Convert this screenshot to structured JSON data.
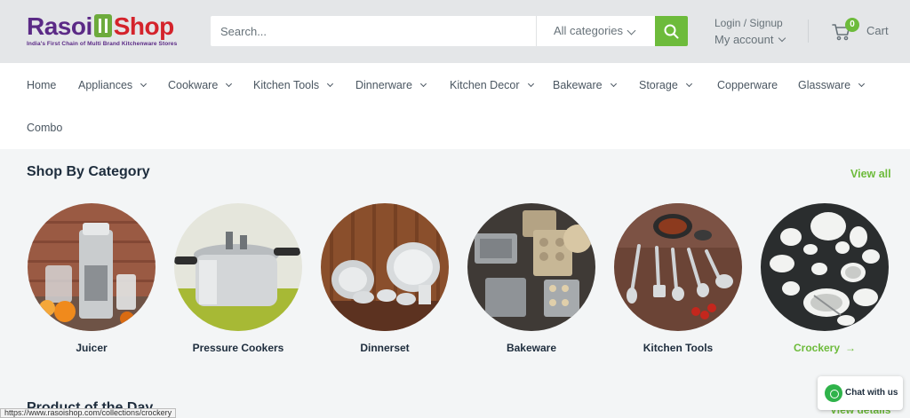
{
  "header": {
    "logo": {
      "word1": "Rasoi",
      "word2": "Shop",
      "tagline": "India's First Chain of Multi Brand Kitchenware Stores"
    },
    "search": {
      "placeholder": "Search...",
      "category": "All categories"
    },
    "account": {
      "login": "Login / Signup",
      "my_account": "My account"
    },
    "cart": {
      "count": "0",
      "label": "Cart"
    }
  },
  "nav": {
    "items": [
      {
        "label": "Home",
        "dropdown": false
      },
      {
        "label": "Appliances",
        "dropdown": true
      },
      {
        "label": "Cookware",
        "dropdown": true
      },
      {
        "label": "Kitchen Tools",
        "dropdown": true
      },
      {
        "label": "Dinnerware",
        "dropdown": true
      },
      {
        "label": "Kitchen Decor",
        "dropdown": true
      },
      {
        "label": "Bakeware",
        "dropdown": true
      },
      {
        "label": "Storage",
        "dropdown": true
      },
      {
        "label": "Copperware",
        "dropdown": false
      },
      {
        "label": "Glassware",
        "dropdown": true
      },
      {
        "label": "Combo",
        "dropdown": false
      }
    ]
  },
  "categories": {
    "title": "Shop By Category",
    "view_all": "View all",
    "items": [
      {
        "label": "Juicer"
      },
      {
        "label": "Pressure Cookers"
      },
      {
        "label": "Dinnerset"
      },
      {
        "label": "Bakeware"
      },
      {
        "label": "Kitchen Tools"
      },
      {
        "label": "Crockery",
        "arrow": "→"
      }
    ]
  },
  "product_of_day": {
    "title": "Product of the Day",
    "view_details": "View details"
  },
  "chat": {
    "label": "Chat with us"
  },
  "status_url": "https://www.rasoishop.com/collections/crockery",
  "colors": {
    "accent": "#6dbb3b",
    "brand_purple": "#5b2a86",
    "brand_red": "#d4232b"
  }
}
